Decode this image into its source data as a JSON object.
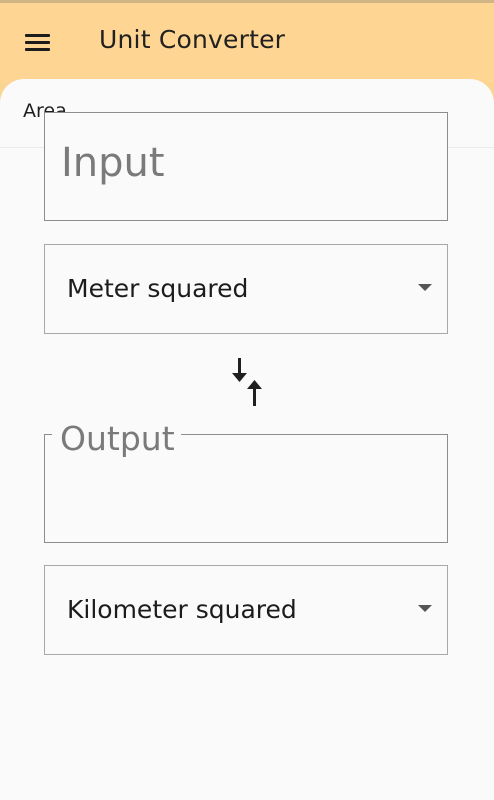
{
  "app": {
    "title": "Unit Converter"
  },
  "category": {
    "label": "Area"
  },
  "input": {
    "placeholder": "Input"
  },
  "from_unit": {
    "selected": "Meter squared"
  },
  "output": {
    "label": "Output"
  },
  "to_unit": {
    "selected": "Kilometer squared"
  },
  "icons": {
    "menu": "menu-icon",
    "swap": "swap-vertical-icon",
    "dropdown": "arrow-drop-down-icon"
  },
  "colors": {
    "appbar": "#fed592",
    "surface": "#fafafa",
    "text": "#212121",
    "hint": "#7a7a7a"
  }
}
